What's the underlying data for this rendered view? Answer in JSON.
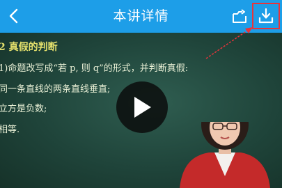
{
  "header": {
    "title": "本讲详情",
    "background": "#1d9ee8"
  },
  "icons": {
    "back": "chevron-left-icon",
    "share": "folder-share-icon",
    "download": "download-icon",
    "play": "play-icon"
  },
  "video": {
    "board_lines": [
      "2 真假的判断",
      "1)命题改写成“若 p, 则 q”的形式，并判断真假:",
      "同一条直线的两条直线垂直;",
      "立方是负数;",
      "相等."
    ]
  },
  "highlight_color": "#e8343a"
}
